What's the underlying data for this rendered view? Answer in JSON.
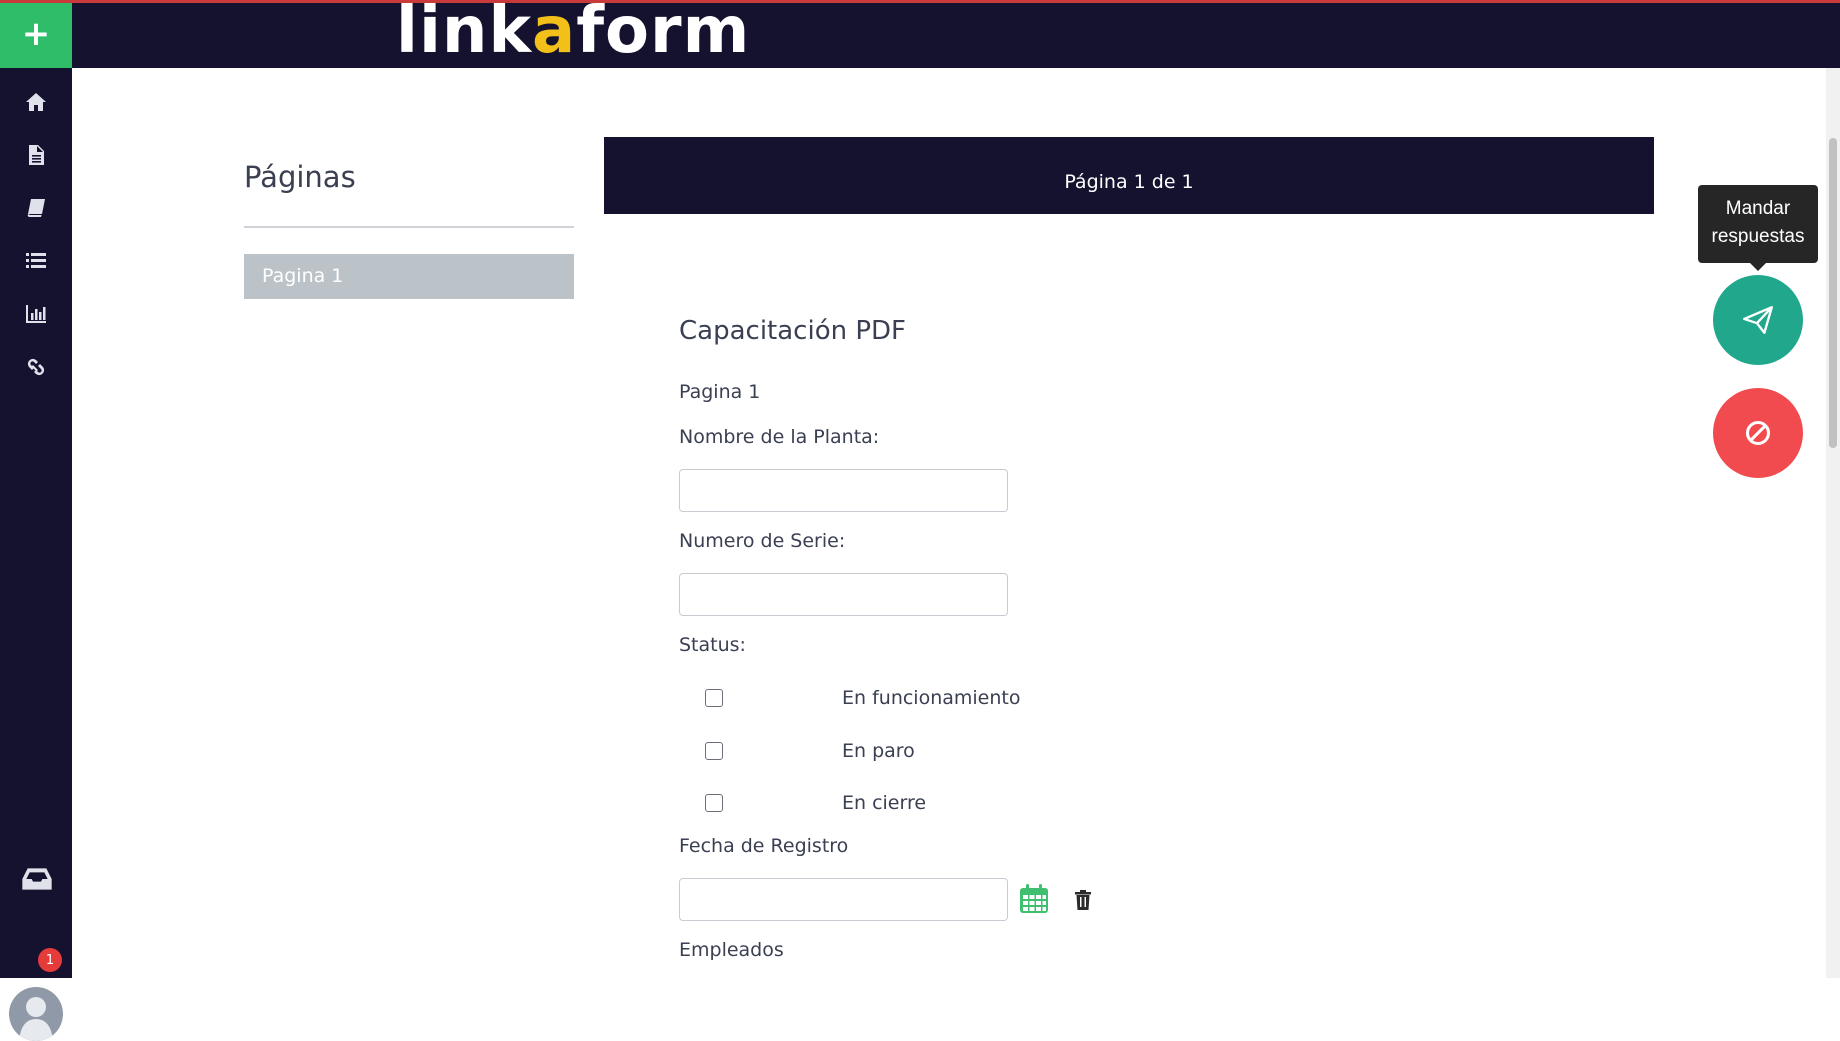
{
  "header": {
    "new_label": "+",
    "logo_part1": "link",
    "logo_part2": "a",
    "logo_part3": "form"
  },
  "sidebar": {
    "icons": [
      "home-icon",
      "document-icon",
      "book-icon",
      "list-icon",
      "bar-chart-icon",
      "link-icon",
      "inbox-icon"
    ],
    "inbox_badge": "1"
  },
  "pages_panel": {
    "title": "Páginas",
    "items": [
      {
        "label": "Pagina 1"
      }
    ]
  },
  "banner": {
    "text": "Página 1 de 1"
  },
  "form": {
    "title": "Capacitación PDF",
    "page_label": "Pagina 1",
    "field_planta": {
      "label": "Nombre de la Planta:",
      "value": ""
    },
    "field_serie": {
      "label": "Numero de Serie:",
      "value": ""
    },
    "status": {
      "label": "Status:",
      "options": [
        {
          "label": "En funcionamiento",
          "checked": false
        },
        {
          "label": "En paro",
          "checked": false
        },
        {
          "label": "En cierre",
          "checked": false
        }
      ]
    },
    "field_fecha": {
      "label": "Fecha de Registro",
      "value": ""
    },
    "empleados_label": "Empleados"
  },
  "actions": {
    "tooltip_line1": "Mandar",
    "tooltip_line2": "respuestas"
  },
  "colors": {
    "header_bg": "#14122f",
    "accent_green": "#2fbd6a",
    "send_green": "#21a88c",
    "cancel_red": "#f24b4f",
    "logo_yellow": "#f2c018"
  }
}
